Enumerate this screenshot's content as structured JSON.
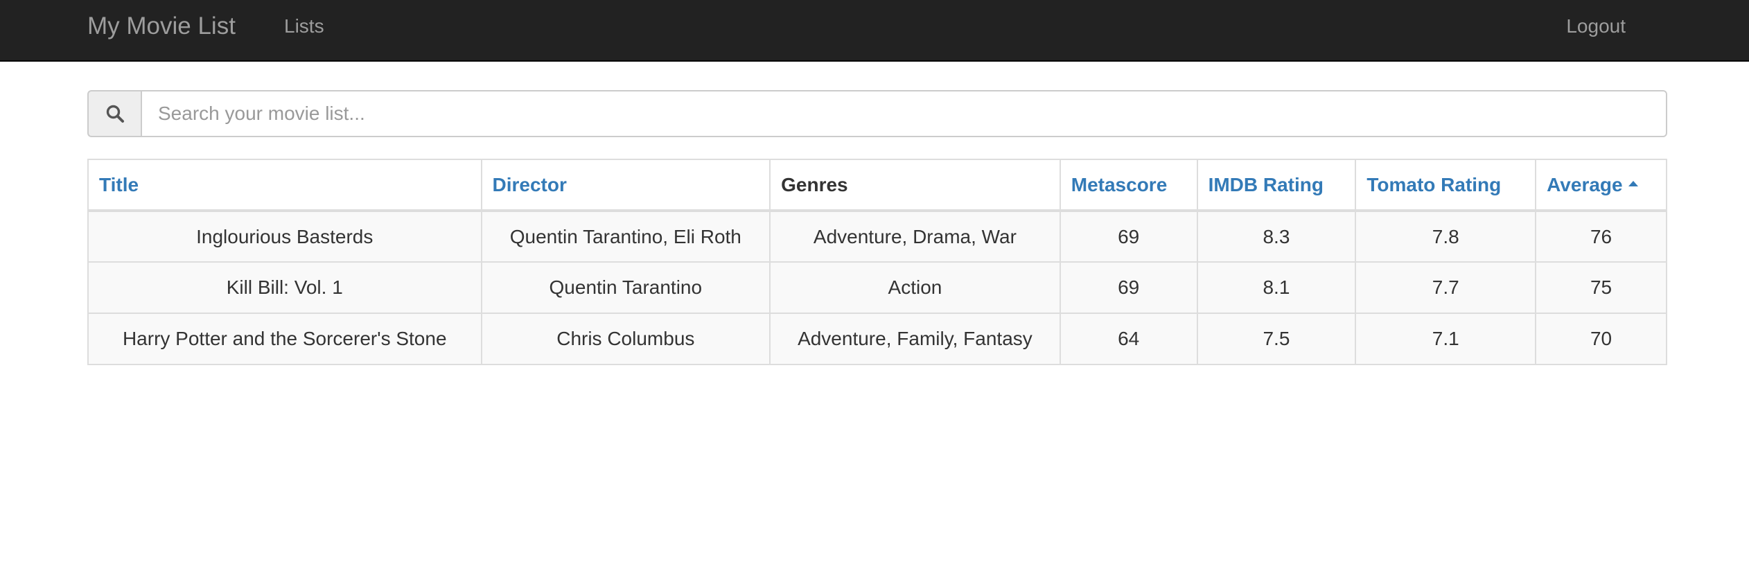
{
  "navbar": {
    "brand": "My Movie List",
    "lists_link": "Lists",
    "logout_link": "Logout"
  },
  "search": {
    "placeholder": "Search your movie list...",
    "value": "",
    "icon": "search-icon"
  },
  "table": {
    "headers": {
      "title": "Title",
      "director": "Director",
      "genres": "Genres",
      "metascore": "Metascore",
      "imdb": "IMDB Rating",
      "tomato": "Tomato Rating",
      "average": "Average"
    },
    "sort": {
      "column": "average",
      "direction": "ascending-caret"
    },
    "rows": [
      {
        "title": "Inglourious Basterds",
        "director": "Quentin Tarantino, Eli Roth",
        "genres": "Adventure, Drama, War",
        "metascore": "69",
        "imdb": "8.3",
        "tomato": "7.8",
        "average": "76"
      },
      {
        "title": "Kill Bill: Vol. 1",
        "director": "Quentin Tarantino",
        "genres": "Action",
        "metascore": "69",
        "imdb": "8.1",
        "tomato": "7.7",
        "average": "75"
      },
      {
        "title": "Harry Potter and the Sorcerer's Stone",
        "director": "Chris Columbus",
        "genres": "Adventure, Family, Fantasy",
        "metascore": "64",
        "imdb": "7.5",
        "tomato": "7.1",
        "average": "70"
      }
    ]
  },
  "colors": {
    "navbar_bg": "#222222",
    "nav_text": "#9d9d9d",
    "link": "#337ab7",
    "text": "#333333",
    "border": "#dddddd",
    "stripe": "#f9f9f9"
  }
}
